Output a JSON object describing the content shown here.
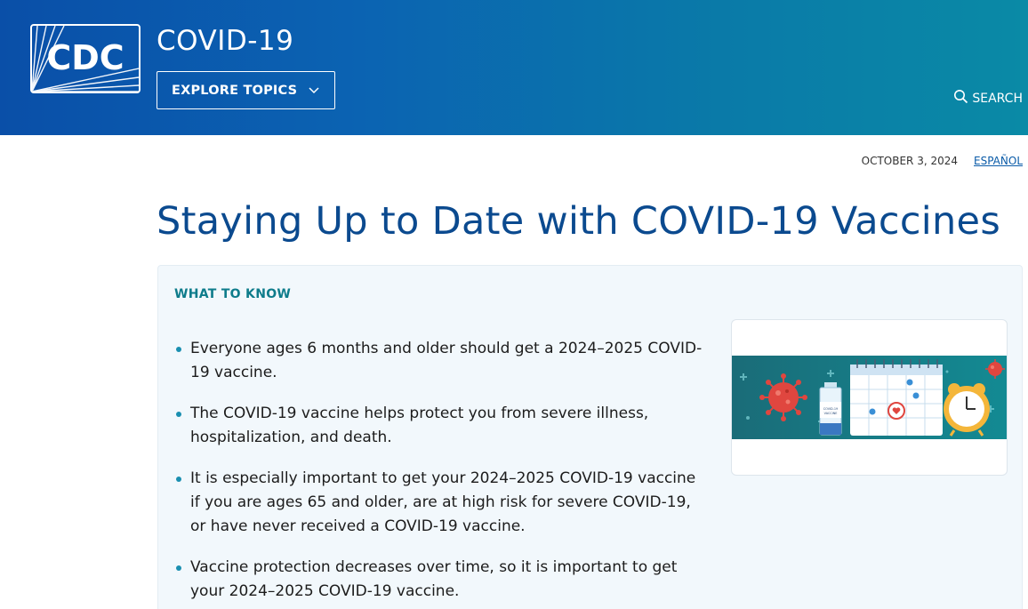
{
  "header": {
    "logo_text": "CDC",
    "site_title": "COVID-19",
    "explore_label": "EXPLORE TOPICS",
    "search_label": "SEARCH",
    "icons": {
      "explore": "chevron-down-icon",
      "search": "search-icon"
    }
  },
  "meta": {
    "date": "OCTOBER 3, 2024",
    "language_link": "ESPAÑOL"
  },
  "main": {
    "title": "Staying Up to Date with COVID-19 Vaccines",
    "summary": {
      "heading": "WHAT TO KNOW",
      "bullets": [
        "Everyone ages 6 months and older should get a 2024–2025 COVID-19 vaccine.",
        "The COVID-19 vaccine helps protect you from severe illness, hospitalization, and death.",
        "It is especially important to get your 2024–2025 COVID-19 vaccine if you are ages 65 and older, are at high risk for severe COVID-19, or have never received a COVID-19 vaccine.",
        "Vaccine protection decreases over time, so it is important to get your 2024–2025 COVID-19 vaccine."
      ],
      "illustration": {
        "vial_label": "COVID-19 VACCINE"
      }
    }
  },
  "colors": {
    "header_start": "#0a4fa8",
    "header_end": "#0a8aa6",
    "title": "#0b4a8f",
    "heading_teal": "#0e7c8b",
    "card_bg": "#f2f8fc",
    "virus_red": "#e0463f",
    "illustration_bg": "#19707a"
  }
}
